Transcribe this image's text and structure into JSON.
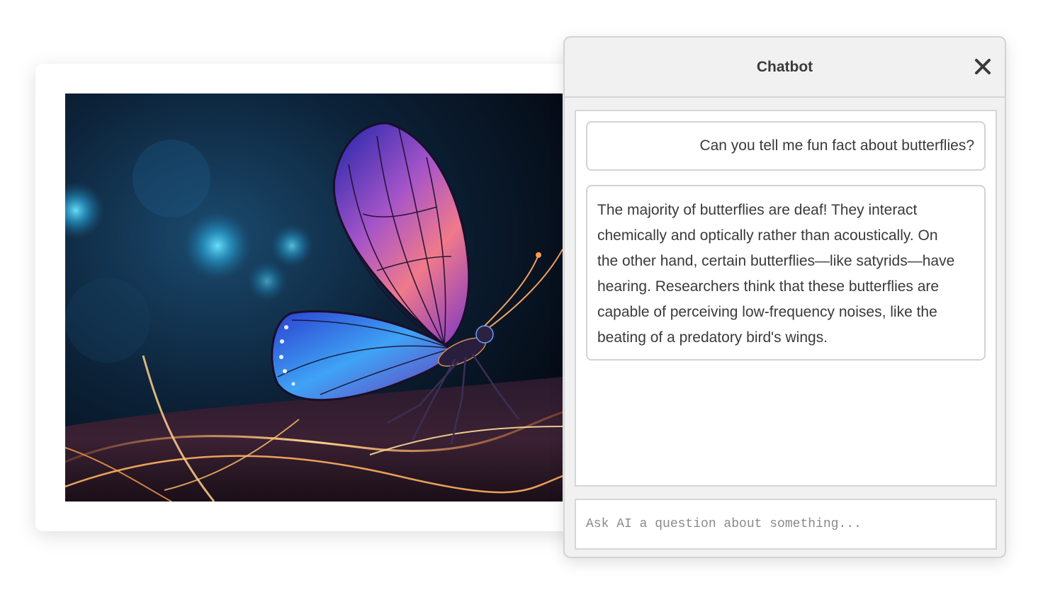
{
  "artwork": {
    "icon": "butterfly-artwork"
  },
  "chat": {
    "title": "Chatbot",
    "close_icon": "close-icon",
    "messages": [
      {
        "role": "user",
        "text": "Can you tell me fun fact about butterflies?"
      },
      {
        "role": "bot",
        "lines": [
          "The majority of butterflies are deaf! They interact",
          "chemically and optically rather than acoustically. On",
          "the other hand, certain butterflies—like satyrids—have",
          "hearing. Researchers think that these butterflies are",
          "capable of perceiving low-frequency noises, like the",
          "beating of a predatory bird's wings."
        ]
      }
    ],
    "input": {
      "placeholder": "Ask AI a question about something...",
      "value": ""
    }
  },
  "colors": {
    "panel_bg": "#f1f1f1",
    "border": "#d3d3d3",
    "text": "#3a3a3a"
  }
}
